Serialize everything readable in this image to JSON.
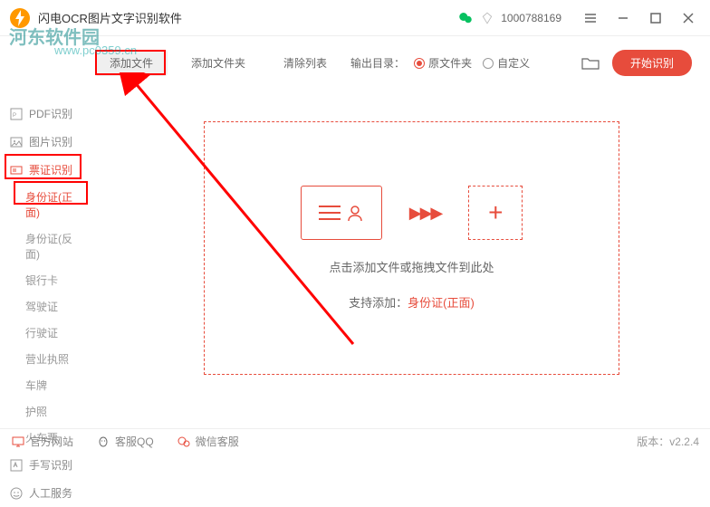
{
  "titlebar": {
    "app_title": "闪电OCR图片文字识别软件",
    "user_id": "1000788169"
  },
  "watermark": {
    "text": "河东软件园",
    "url": "www.pc0359.cn"
  },
  "sidebar": {
    "pdf": "PDF识别",
    "image": "图片识别",
    "ticket": "票证识别",
    "handwrite": "手写识别",
    "manual": "人工服务",
    "subs": {
      "id_front": "身份证(正面)",
      "id_back": "身份证(反面)",
      "bank": "银行卡",
      "drive": "驾驶证",
      "vehicle": "行驶证",
      "license": "营业执照",
      "plate": "车牌",
      "passport": "护照",
      "train": "火车票"
    }
  },
  "toolbar": {
    "add_file": "添加文件",
    "add_folder": "添加文件夹",
    "clear": "清除列表",
    "output_label": "输出目录：",
    "radio_original": "原文件夹",
    "radio_custom": "自定义",
    "start": "开始识别"
  },
  "dropzone": {
    "main_text": "点击添加文件或拖拽文件到此处",
    "sub_prefix": "支持添加：",
    "sub_type": "身份证(正面)"
  },
  "footer": {
    "site": "官方网站",
    "qq": "客服QQ",
    "wechat": "微信客服",
    "version": "版本：v2.2.4"
  }
}
